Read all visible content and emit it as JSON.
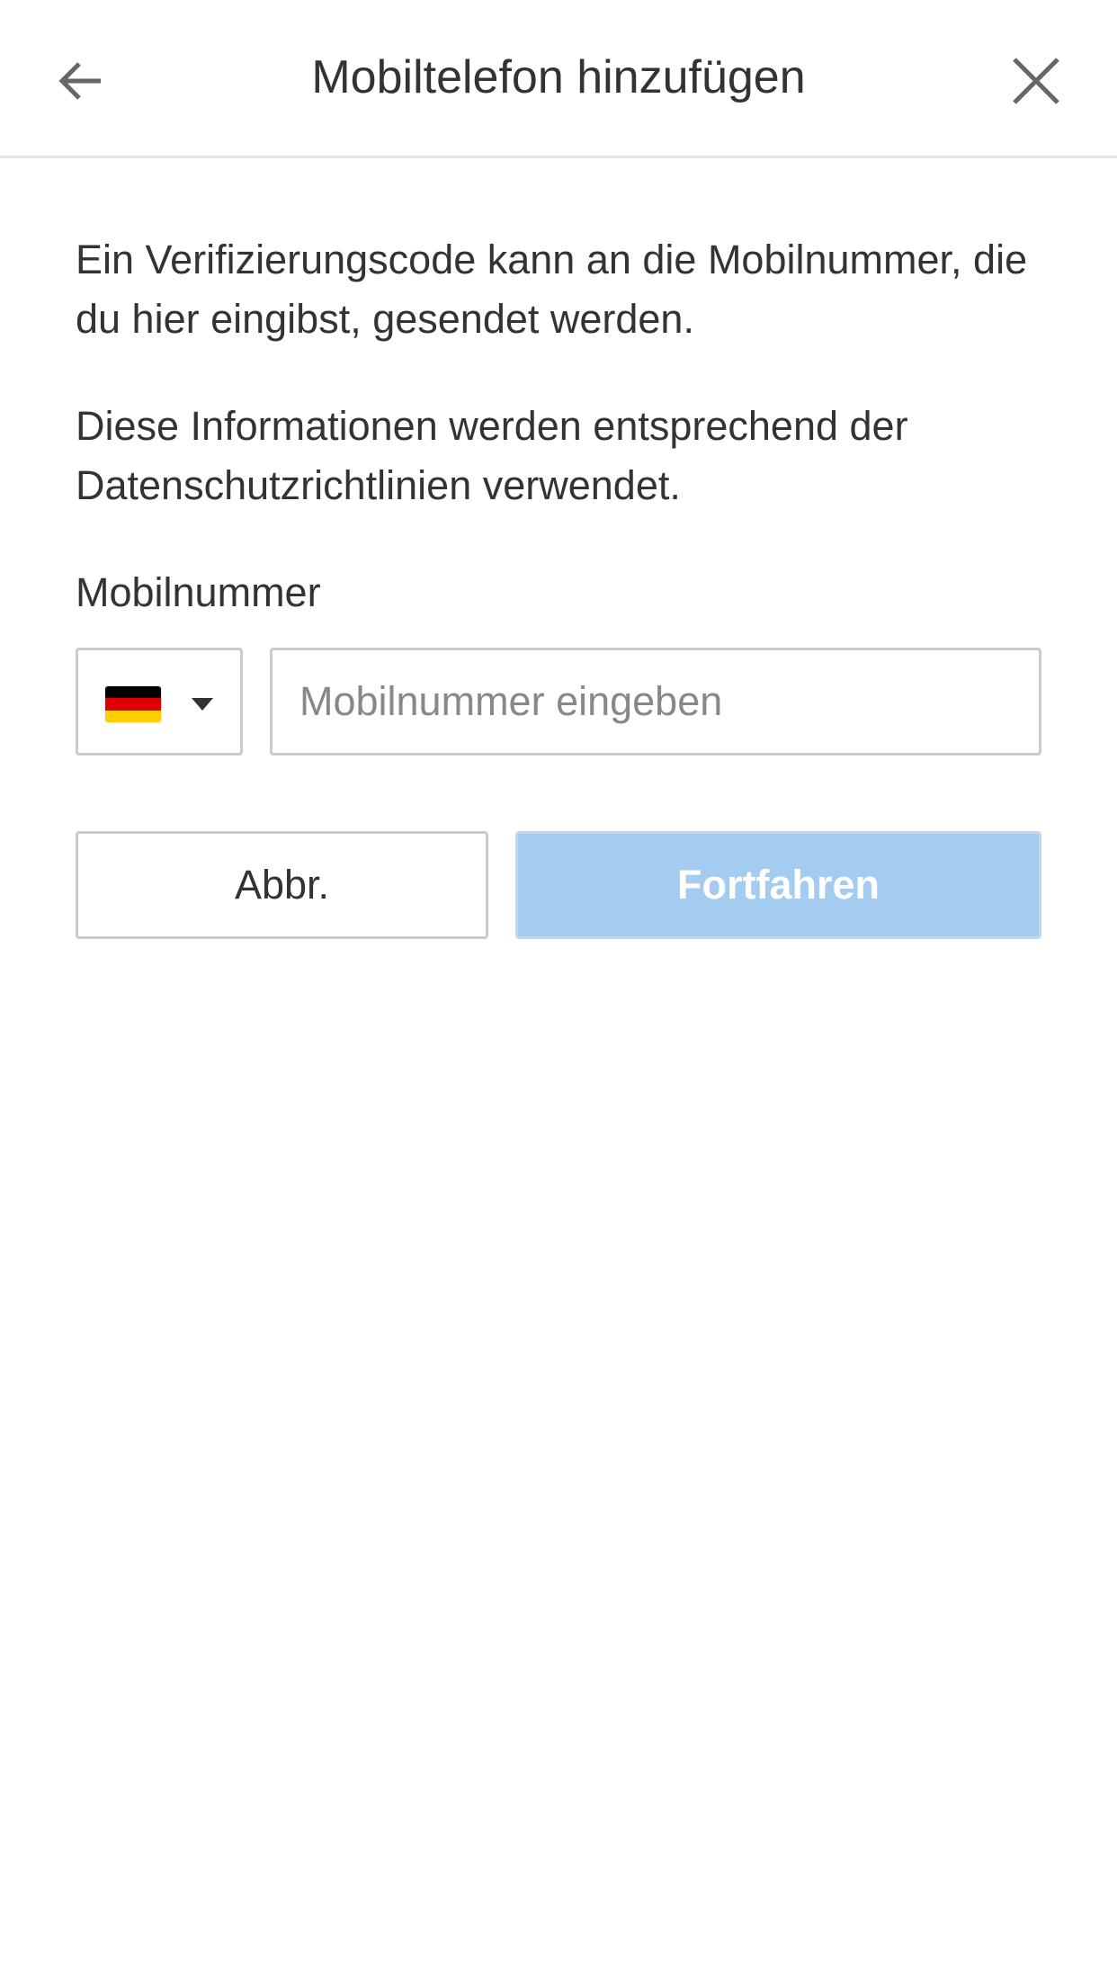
{
  "header": {
    "title": "Mobiltelefon hinzufügen",
    "back_icon": "arrow-left-icon",
    "close_icon": "close-icon"
  },
  "content": {
    "paragraph_1": "Ein Verifizierungscode kann an die Mobilnummer, die du hier eingibst, gesendet werden.",
    "paragraph_2": "Diese Informationen werden entsprechend der Datenschutzrichtlinien verwendet.",
    "phone_label": "Mobilnummer",
    "country_select": {
      "flag_icon": "germany-flag-icon",
      "flag_colors": [
        "#000000",
        "#dd0000",
        "#ffce00"
      ],
      "caret_icon": "caret-down-icon"
    },
    "phone_input": {
      "value": "",
      "placeholder": "Mobilnummer eingeben"
    }
  },
  "buttons": {
    "cancel_label": "Abbr.",
    "continue_label": "Fortfahren",
    "continue_color": "#a4cbf0"
  }
}
